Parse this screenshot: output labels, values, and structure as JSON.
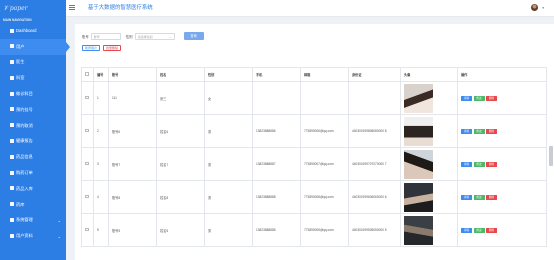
{
  "app": {
    "logo_text": "paper",
    "title": "基于大数据的智慧医疗系统"
  },
  "sidebar": {
    "nav_title": "MAIN NAVIGATION",
    "items": [
      {
        "label": "Dashboard",
        "icon": "dashboard-icon"
      },
      {
        "label": "用户",
        "icon": "user-icon"
      },
      {
        "label": "医生",
        "icon": "doctor-icon"
      },
      {
        "label": "科室",
        "icon": "department-icon"
      },
      {
        "label": "做诊科目",
        "icon": "subject-icon"
      },
      {
        "label": "预约挂号",
        "icon": "appointment-icon"
      },
      {
        "label": "预约取消",
        "icon": "cancel-icon"
      },
      {
        "label": "健康报告",
        "icon": "report-icon"
      },
      {
        "label": "药品信息",
        "icon": "medicine-icon"
      },
      {
        "label": "购药订单",
        "icon": "order-icon"
      },
      {
        "label": "药品入库",
        "icon": "warehouse-icon"
      },
      {
        "label": "药库",
        "icon": "storage-icon"
      },
      {
        "label": "系统管理",
        "icon": "settings-icon"
      },
      {
        "label": "用户资料",
        "icon": "profile-icon"
      }
    ]
  },
  "search": {
    "account_label": "账号",
    "account_placeholder": "账号",
    "gender_label": "性别",
    "gender_placeholder": "请选择性别",
    "query_button": "查询"
  },
  "actions": {
    "add_label": "新增用户",
    "delete_label": "批量删除"
  },
  "table": {
    "headers": [
      "",
      "编号",
      "账号",
      "姓名",
      "性别",
      "手机",
      "邮箱",
      "身份证",
      "头像",
      "操作"
    ],
    "rows": [
      {
        "no": "1",
        "account": "111",
        "name": "张三",
        "gender": "女",
        "phone": "",
        "email": "",
        "idcard": ""
      },
      {
        "no": "2",
        "account": "账号6",
        "name": "姓名6",
        "gender": "男",
        "phone": "13823888886",
        "email": "773890006@qq.com",
        "idcard": "440300199808080000 8"
      },
      {
        "no": "3",
        "account": "账号7",
        "name": "姓名7",
        "gender": "男",
        "phone": "13823888887",
        "email": "773890007@qq.com",
        "idcard": "440300199707070000 7"
      },
      {
        "no": "4",
        "account": "账号8",
        "name": "姓名8",
        "gender": "男",
        "phone": "13823888888",
        "email": "773890008@qq.com",
        "idcard": "440300199606060000 6"
      },
      {
        "no": "5",
        "account": "账号5",
        "name": "姓名5",
        "gender": "男",
        "phone": "13823888885",
        "email": "773890005@qq.com",
        "idcard": "440300199505050000 5"
      }
    ],
    "op_view": "详情",
    "op_edit": "修改",
    "op_delete": "删除"
  },
  "colors": {
    "sidebar": "#2d7ee4",
    "primary": "#3f8cf0",
    "success": "#4cb86a",
    "danger": "#e5484d"
  }
}
